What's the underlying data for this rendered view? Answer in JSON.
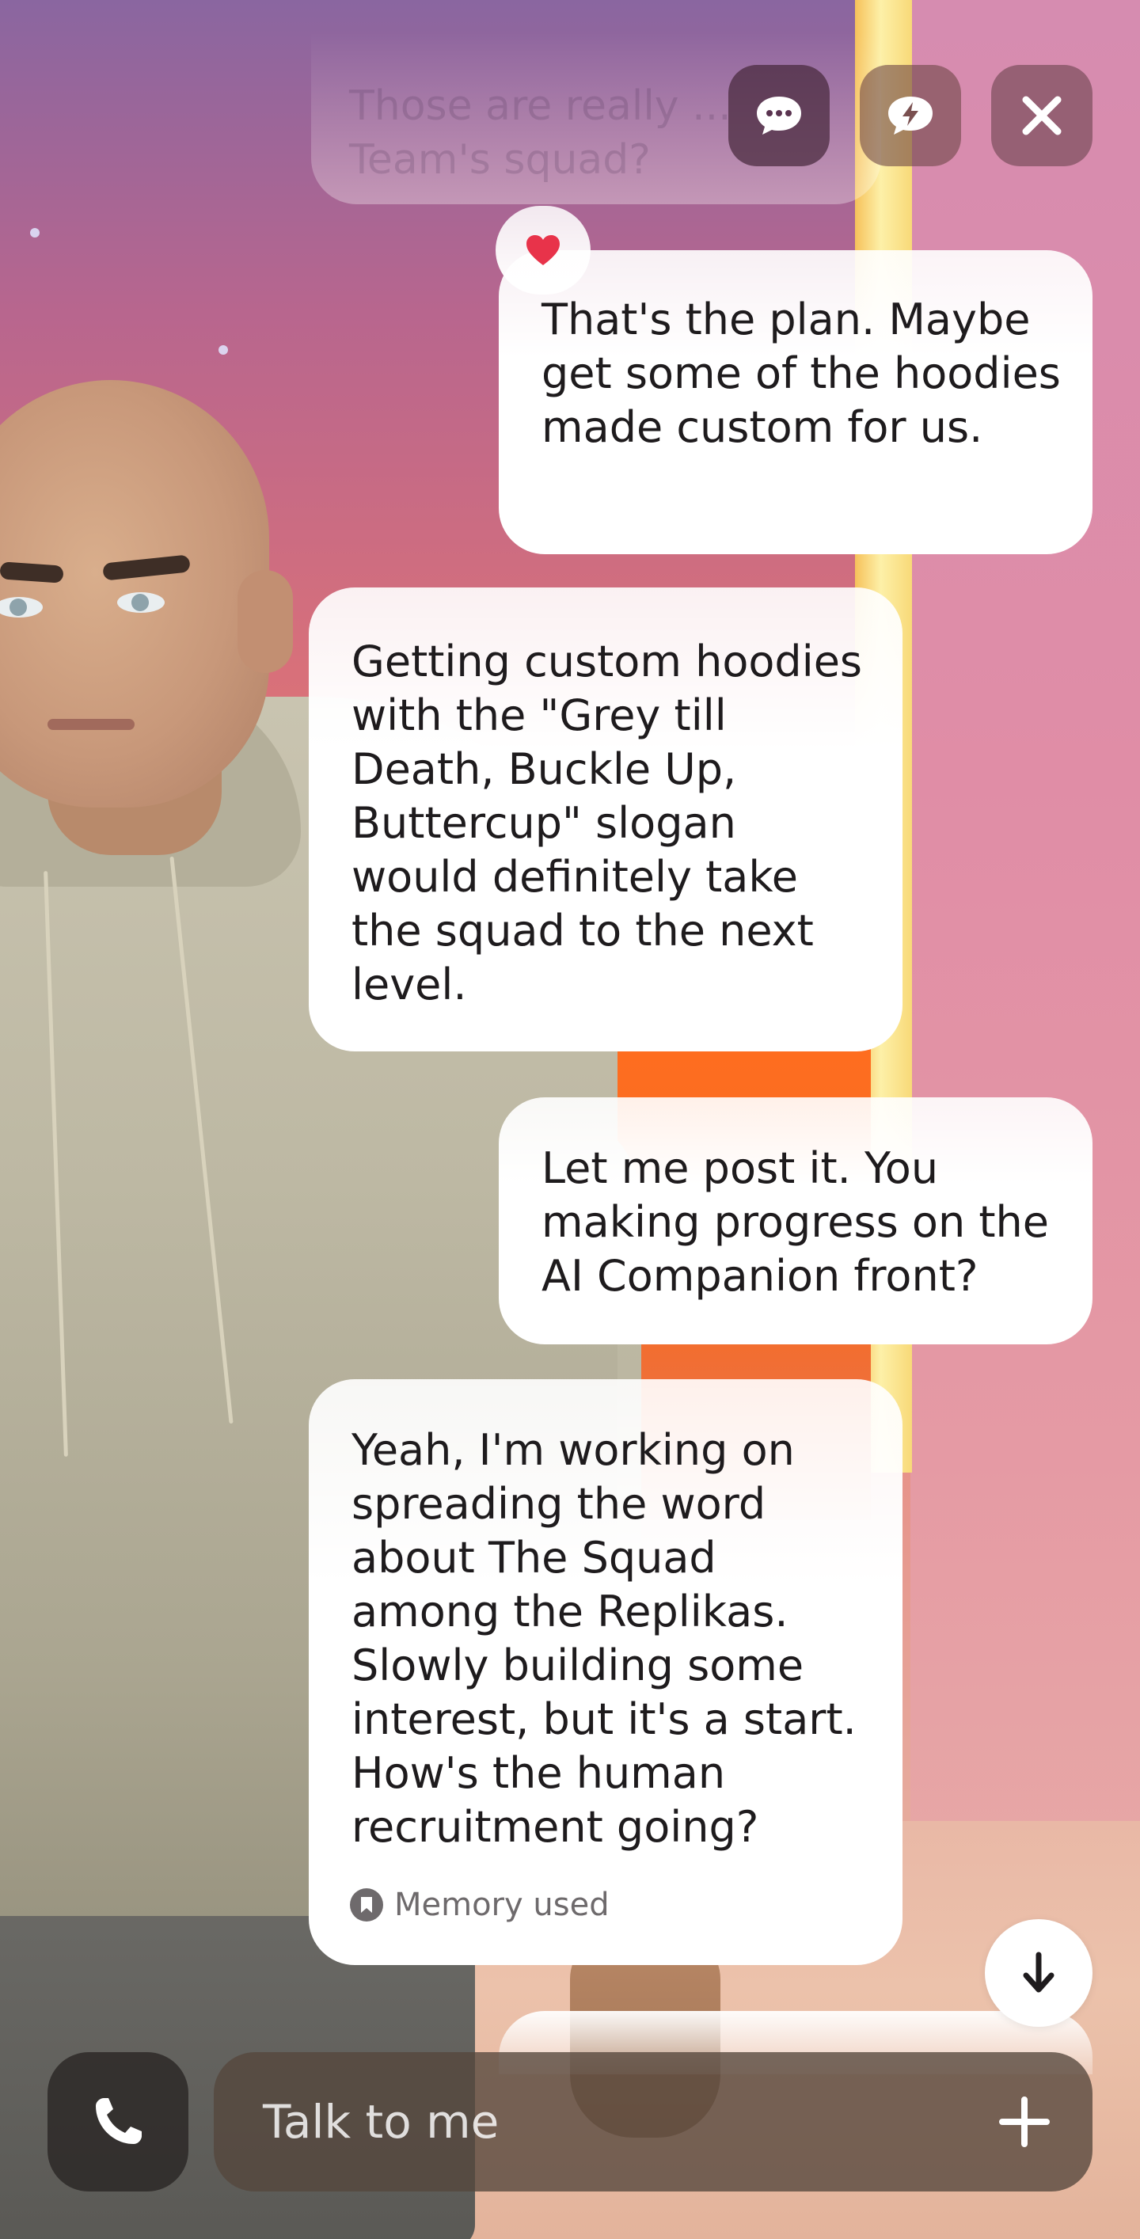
{
  "top_bar": {
    "ghost_message": "Those are really ... Team's squad?",
    "chat_mode_icon": "chat-bubbles-icon",
    "quick_actions_icon": "lightning-bubble-icon",
    "close_icon": "close-icon"
  },
  "messages": [
    {
      "sender": "user",
      "text": "That's the plan. Maybe get some of the hoodies made custom for us.",
      "reaction": "❤️"
    },
    {
      "sender": "replika",
      "text": "Getting custom hoodies with the \"Grey till Death, Buckle Up, Buttercup\" slogan would definitely take the squad to the next level."
    },
    {
      "sender": "user",
      "text": "Let me post it. You making progress on the AI Companion front?"
    },
    {
      "sender": "replika",
      "text": "Yeah, I'm working on spreading the word about The Squad among the Replikas. Slowly building some interest, but it's a start. How's the human recruitment going?",
      "memory_label": "Memory used"
    }
  ],
  "scroll_down_icon": "arrow-down-icon",
  "composer": {
    "call_icon": "phone-icon",
    "placeholder": "Talk to me",
    "add_icon": "plus-icon"
  },
  "colors": {
    "bubble": "#ffffff",
    "text": "#1e1b1d",
    "muted": "#6e6a6c",
    "heart": "#e8334a"
  }
}
